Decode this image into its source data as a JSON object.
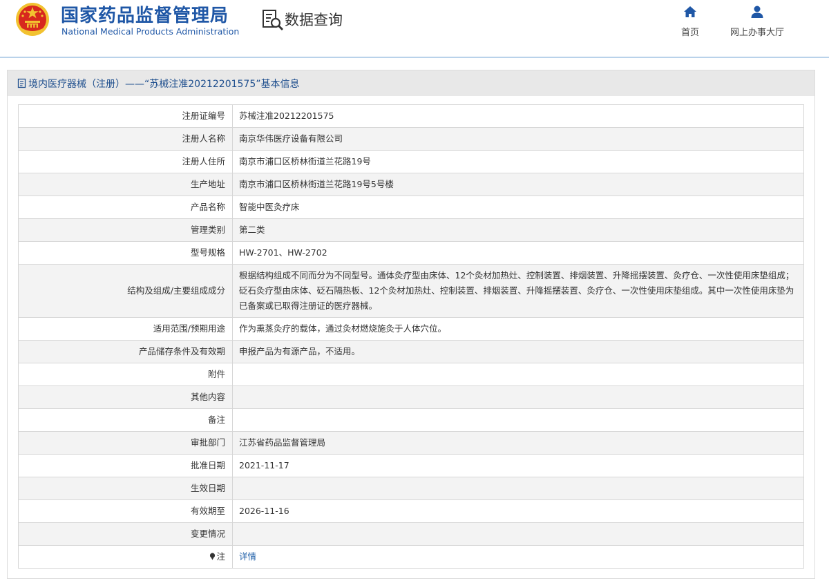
{
  "header": {
    "title_cn": "国家药品监督管理局",
    "title_en": "National Medical Products Administration",
    "query_label": "数据查询",
    "nav": {
      "home": "首页",
      "hall": "网上办事大厅"
    }
  },
  "panel": {
    "title": "境内医疗器械（注册）——“苏械注准20212201575”基本信息"
  },
  "fields": [
    {
      "label": "注册证编号",
      "value": "苏械注准20212201575"
    },
    {
      "label": "注册人名称",
      "value": "南京华伟医疗设备有限公司"
    },
    {
      "label": "注册人住所",
      "value": "南京市浦口区桥林街道兰花路19号"
    },
    {
      "label": "生产地址",
      "value": "南京市浦口区桥林街道兰花路19号5号楼"
    },
    {
      "label": "产品名称",
      "value": "智能中医灸疗床"
    },
    {
      "label": "管理类别",
      "value": "第二类"
    },
    {
      "label": "型号规格",
      "value": "HW-2701、HW-2702"
    },
    {
      "label": "结构及组成/主要组成成分",
      "value": "根据结构组成不同而分为不同型号。通体灸疗型由床体、12个灸材加热灶、控制装置、排烟装置、升降摇摆装置、灸疗仓、一次性使用床垫组成；砭石灸疗型由床体、砭石隔热板、12个灸材加热灶、控制装置、排烟装置、升降摇摆装置、灸疗仓、一次性使用床垫组成。其中一次性使用床垫为已备案或已取得注册证的医疗器械。"
    },
    {
      "label": "适用范围/预期用途",
      "value": "作为熏蒸灸疗的载体，通过灸材燃烧施灸于人体穴位。"
    },
    {
      "label": "产品储存条件及有效期",
      "value": "申报产品为有源产品，不适用。"
    },
    {
      "label": "附件",
      "value": ""
    },
    {
      "label": "其他内容",
      "value": ""
    },
    {
      "label": "备注",
      "value": ""
    },
    {
      "label": "审批部门",
      "value": "江苏省药品监督管理局"
    },
    {
      "label": "批准日期",
      "value": "2021-11-17"
    },
    {
      "label": "生效日期",
      "value": ""
    },
    {
      "label": "有效期至",
      "value": "2026-11-16"
    },
    {
      "label": "变更情况",
      "value": ""
    }
  ],
  "note": {
    "label": "注",
    "link_text": "详情"
  },
  "colors": {
    "brand_blue": "#1f57a6",
    "link_blue": "#1f5fa8",
    "emblem_red": "#d7281e",
    "emblem_gold": "#f2c230"
  },
  "icons": {
    "emblem": "national-emblem-icon",
    "query": "document-search-icon",
    "home": "home-icon",
    "hall": "user-icon",
    "panel": "document-icon",
    "note": "pin-icon"
  }
}
